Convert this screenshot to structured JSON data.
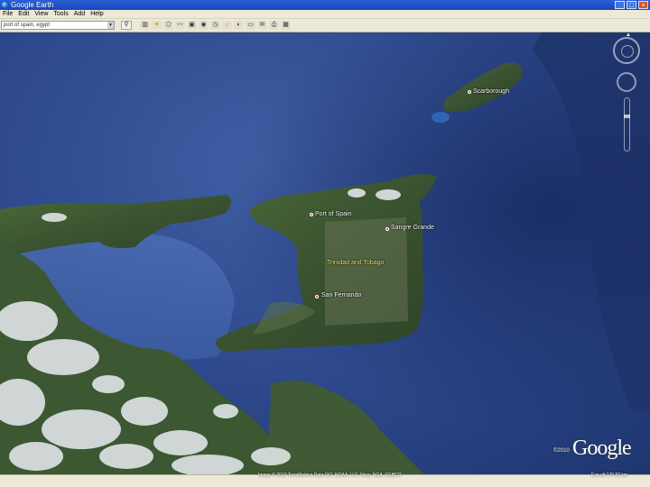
{
  "window": {
    "title": "Google Earth",
    "controls": [
      "_",
      "□",
      "×"
    ]
  },
  "menu": [
    "File",
    "Edit",
    "View",
    "Tools",
    "Add",
    "Help"
  ],
  "search": {
    "value": "port of spain, egypt",
    "button_icon": "search-icon"
  },
  "toolbar_icons": [
    "sidebar-icon",
    "placemark-icon",
    "polygon-icon",
    "path-icon",
    "image-overlay-icon",
    "tour-icon",
    "history-icon",
    "sun-icon",
    "planets-icon",
    "ruler-icon",
    "email-icon",
    "print-icon",
    "view-in-maps-icon"
  ],
  "map": {
    "places": [
      {
        "name": "Scarborough",
        "kind": "city"
      },
      {
        "name": "Port of Spain",
        "kind": "city"
      },
      {
        "name": "Sangre Grande",
        "kind": "city"
      },
      {
        "name": "Trinidad and Tobago",
        "kind": "country"
      },
      {
        "name": "San Fernando",
        "kind": "city"
      }
    ],
    "logo": "Google",
    "copyright": "©2010",
    "pointer_readout": "Image © 2010 TerraMetrics  Data SIO, NOAA, U.S. Navy, NGA, GEBCO",
    "eye_alt": "Eye alt 176.83 km"
  },
  "colors": {
    "ocean": "#2f4a8e",
    "land": "#3e5a2f",
    "title_bar": "#1b45b8",
    "chrome": "#ece9d8"
  }
}
